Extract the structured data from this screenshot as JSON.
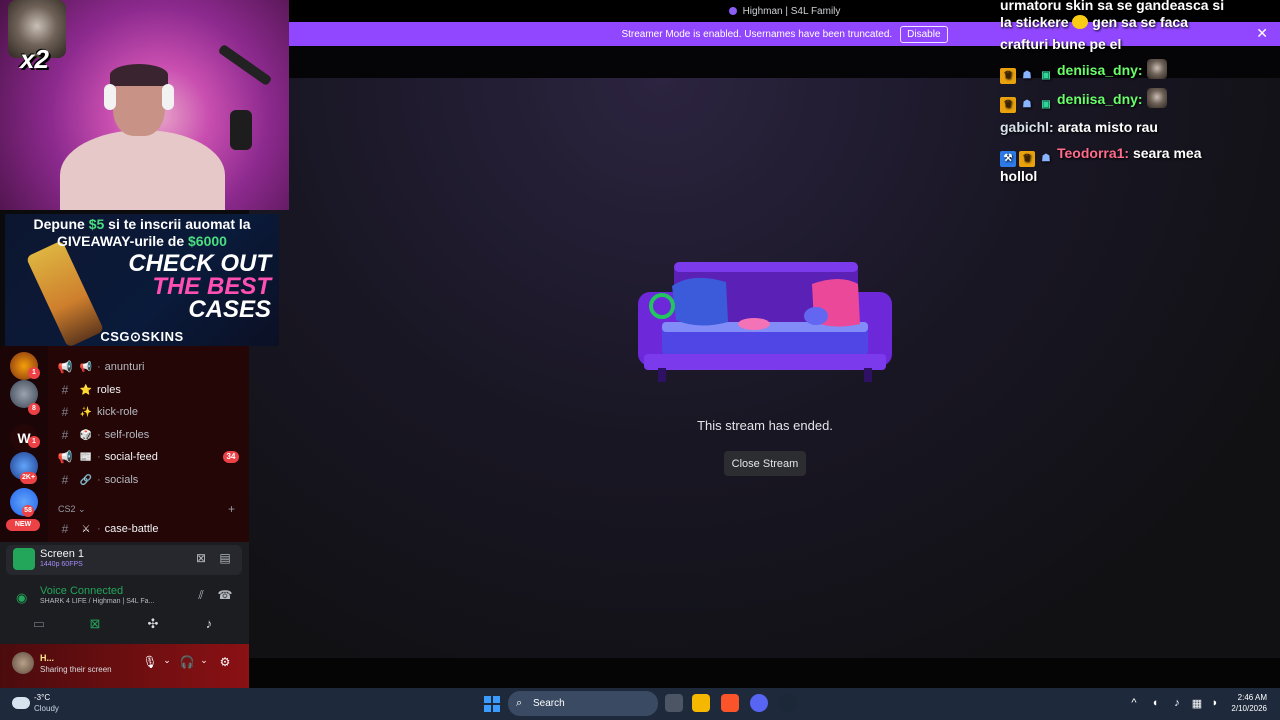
{
  "window": {
    "title": "Highman | S4L Family"
  },
  "banner": {
    "text": "Streamer Mode is enabled. Usernames have been truncated.",
    "button": "Disable",
    "close": "✕"
  },
  "stream": {
    "ended_text": "This stream has ended.",
    "close_button": "Close Stream"
  },
  "webcam": {
    "multiplier": "x2"
  },
  "ad": {
    "line1_a": "Depune ",
    "line1_amount": "$5",
    "line1_b": " si te inscrii auomat la",
    "line2_a": "GIVEAWAY-urile de ",
    "line2_amount": "$6000",
    "cta_1": "CHECK OUT",
    "cta_2": "THE BEST",
    "cta_3": "CASES",
    "brand": "CSG⊙SKINS"
  },
  "servers": {
    "badges": [
      "1",
      "8",
      "1",
      "2K+",
      "58"
    ],
    "new": "NEW"
  },
  "channels": [
    {
      "name": "anunturi",
      "emoji": "📢",
      "bold": false
    },
    {
      "name": "roles",
      "emoji": "⭐",
      "bold": true
    },
    {
      "name": "kick-role",
      "emoji": "✨",
      "bold": false
    },
    {
      "name": "self-roles",
      "emoji": "🎲",
      "bold": false
    },
    {
      "name": "social-feed",
      "emoji": "📰",
      "bold": true,
      "badge": "34"
    },
    {
      "name": "socials",
      "emoji": "🔗",
      "bold": false
    },
    {
      "name": "case-battle",
      "emoji": "⚔",
      "bold": true
    }
  ],
  "category": {
    "name": "CS2",
    "chevron": "⌄",
    "add": "+"
  },
  "screen_share": {
    "title": "Screen 1",
    "subtitle": "1440p 60FPS"
  },
  "voice": {
    "title": "Voice Connected",
    "subtitle": "SHARK 4 LIFE / Highman | S4L Fa..."
  },
  "user": {
    "name": "H...",
    "status": "Sharing their screen"
  },
  "chat": {
    "top_line_1": "urmatoru skin sa se gandeasca si",
    "top_line_2": "la stickere",
    "top_line_2b": " gen sa se faca",
    "top_line_3": "crafturi bune pe el",
    "messages": [
      {
        "user": "deniisa_dny:",
        "text": "",
        "color": "green"
      },
      {
        "user": "deniisa_dny:",
        "text": "",
        "color": "green"
      },
      {
        "user": "gabichl:",
        "text": "arata misto rau",
        "color": "gray"
      },
      {
        "user": "Teodorra1:",
        "text": "seara mea",
        "text2": "hollol",
        "color": "pink"
      }
    ]
  },
  "taskbar": {
    "weather_temp": "-3°C",
    "weather_desc": "Cloudy",
    "search": "Search",
    "time": "2:46 AM",
    "date": "2/10/2026"
  },
  "colors": {
    "brand_purple": "#9147ff",
    "discord_green": "#23a55a",
    "notification_red": "#ed4245"
  }
}
